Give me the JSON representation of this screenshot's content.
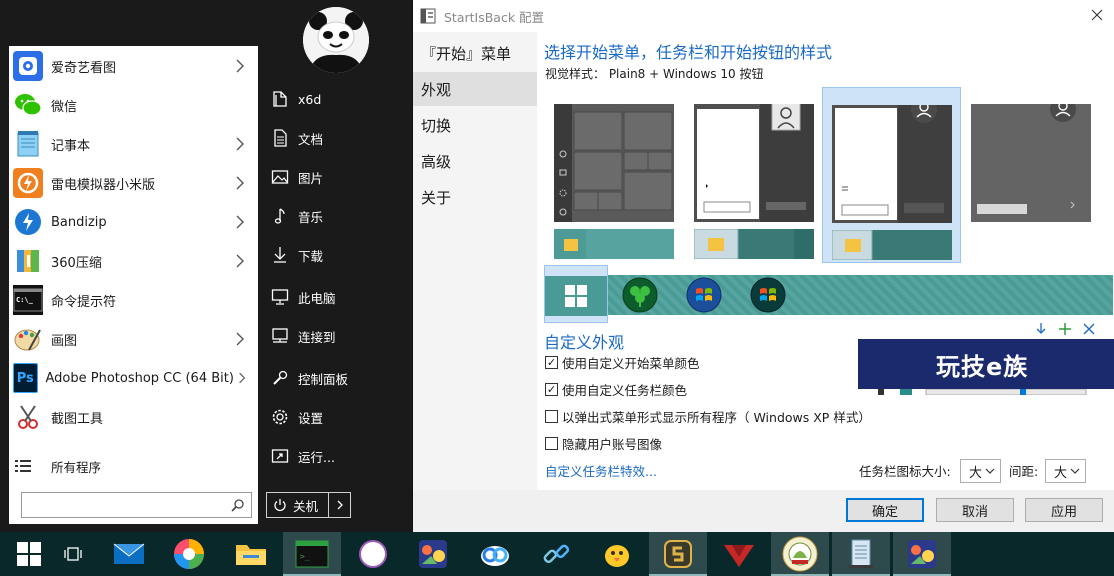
{
  "start_menu": {
    "apps": [
      {
        "label": "爱奇艺看图",
        "icon": "iqiyi-viewer-icon",
        "has_arrow": true
      },
      {
        "label": "微信",
        "icon": "wechat-icon",
        "has_arrow": false
      },
      {
        "label": "记事本",
        "icon": "notepad-icon",
        "has_arrow": true
      },
      {
        "label": "雷电模拟器小米版",
        "icon": "ldplayer-icon",
        "has_arrow": true
      },
      {
        "label": "Bandizip",
        "icon": "bandizip-icon",
        "has_arrow": true
      },
      {
        "label": "360压缩",
        "icon": "360-compress-icon",
        "has_arrow": true
      },
      {
        "label": "命令提示符",
        "icon": "cmd-icon",
        "has_arrow": false
      },
      {
        "label": "画图",
        "icon": "paint-icon",
        "has_arrow": true
      },
      {
        "label": "Adobe Photoshop CC (64 Bit)",
        "icon": "photoshop-icon",
        "has_arrow": true
      },
      {
        "label": "截图工具",
        "icon": "snipping-tool-icon",
        "has_arrow": false
      }
    ],
    "all_programs": "所有程序",
    "search_value": "",
    "right_items": [
      {
        "label": "x6d",
        "icon": "user-folder-icon"
      },
      {
        "label": "文档",
        "icon": "documents-icon"
      },
      {
        "label": "图片",
        "icon": "pictures-icon"
      },
      {
        "label": "音乐",
        "icon": "music-icon"
      },
      {
        "label": "下载",
        "icon": "downloads-icon"
      },
      {
        "label": "此电脑",
        "icon": "this-pc-icon"
      },
      {
        "label": "连接到",
        "icon": "connect-to-icon"
      },
      {
        "label": "控制面板",
        "icon": "control-panel-icon"
      },
      {
        "label": "设置",
        "icon": "settings-gear-icon"
      },
      {
        "label": "运行...",
        "icon": "run-icon"
      }
    ],
    "shutdown_label": "关机"
  },
  "config_window": {
    "title": "StartIsBack 配置",
    "nav": [
      "『开始』菜单",
      "外观",
      "切换",
      "高级",
      "关于"
    ],
    "active_nav": "外观",
    "heading": "选择开始菜单，任务栏和开始按钮的样式",
    "visual_style": "视觉样式： Plain8 + Windows 10 按钮",
    "custom_heading": "自定义外观",
    "checkboxes": [
      {
        "label": "使用自定义开始菜单颜色",
        "checked": true
      },
      {
        "label": "使用自定义任务栏颜色",
        "checked": true
      },
      {
        "label": "以弹出式菜单形式显示所有程序（ Windows XP 样式）",
        "checked": false
      },
      {
        "label": "隐藏用户账号图像",
        "checked": false
      }
    ],
    "taskbar_effects_link": "自定义任务栏特效...",
    "icon_size_label": "任务栏图标大小:",
    "icon_size_value": "大",
    "spacing_label": "间距:",
    "spacing_value": "大",
    "watermark": "玩技e族",
    "buttons": {
      "ok": "确定",
      "cancel": "取消",
      "apply": "应用"
    }
  },
  "taskbar": {
    "items": [
      "start-button-icon",
      "task-view-icon",
      "mail-icon",
      "photo-app-icon",
      "file-explorer-icon",
      "terminal-app-icon",
      "circle-app-icon",
      "game-app-icon",
      "baidu-netdisk-icon",
      "link-tool-icon",
      "chick-app-icon",
      "s-app-icon",
      "red-arrow-icon",
      "badge-app-icon",
      "notepad-window-icon",
      "game-app-icon-2"
    ]
  }
}
